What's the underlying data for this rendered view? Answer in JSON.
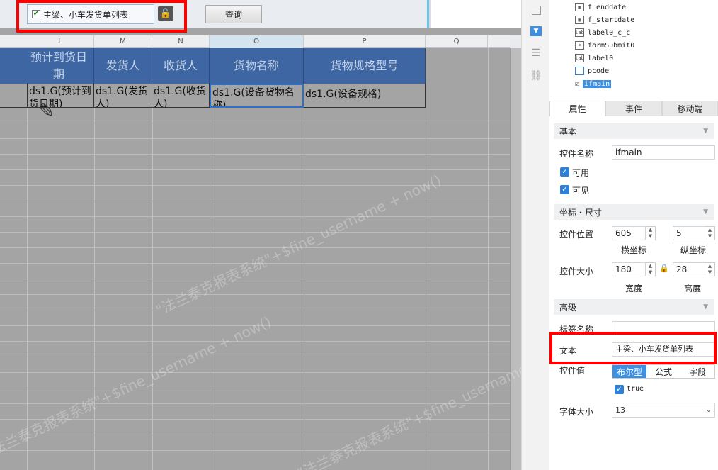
{
  "param": {
    "checkbox_label": "主梁、小车发货单列表",
    "query_label": "查询"
  },
  "columns": [
    "L",
    "M",
    "N",
    "O",
    "P",
    "Q"
  ],
  "table": {
    "headers": [
      "预计到货日期",
      "发货人",
      "收货人",
      "货物名称",
      "货物规格型号"
    ],
    "cells": [
      "ds1.G(预计到货日期)",
      "ds1.G(发货人)",
      "ds1.G(收货人)",
      "ds1.G(设备货物名称)",
      "ds1.G(设备规格)"
    ]
  },
  "watermark": "\"法兰泰克报表系统\"+$fine_username + now()",
  "tree": [
    "f_enddate",
    "f_startdate",
    "label0_c_c",
    "formSubmit0",
    "label0",
    "pcode",
    "ifmain"
  ],
  "tabs": [
    "属性",
    "事件",
    "移动端"
  ],
  "props": {
    "section_basic": "基本",
    "widget_name_label": "控件名称",
    "widget_name": "ifmain",
    "enabled": "可用",
    "visible": "可见",
    "section_coord": "坐标・尺寸",
    "pos_label": "控件位置",
    "pos_x": "605",
    "pos_y": "5",
    "x_label": "横坐标",
    "y_label": "纵坐标",
    "size_label": "控件大小",
    "width": "180",
    "height": "28",
    "w_label": "宽度",
    "h_label": "高度",
    "section_adv": "高级",
    "tag_label": "标签名称",
    "tag_value": "",
    "text_label": "文本",
    "text_value": "主梁、小车发货单列表",
    "value_label": "控件值",
    "seg": [
      "布尔型",
      "公式",
      "字段"
    ],
    "bool_value": "true",
    "font_label": "字体大小",
    "font_size": "13"
  }
}
